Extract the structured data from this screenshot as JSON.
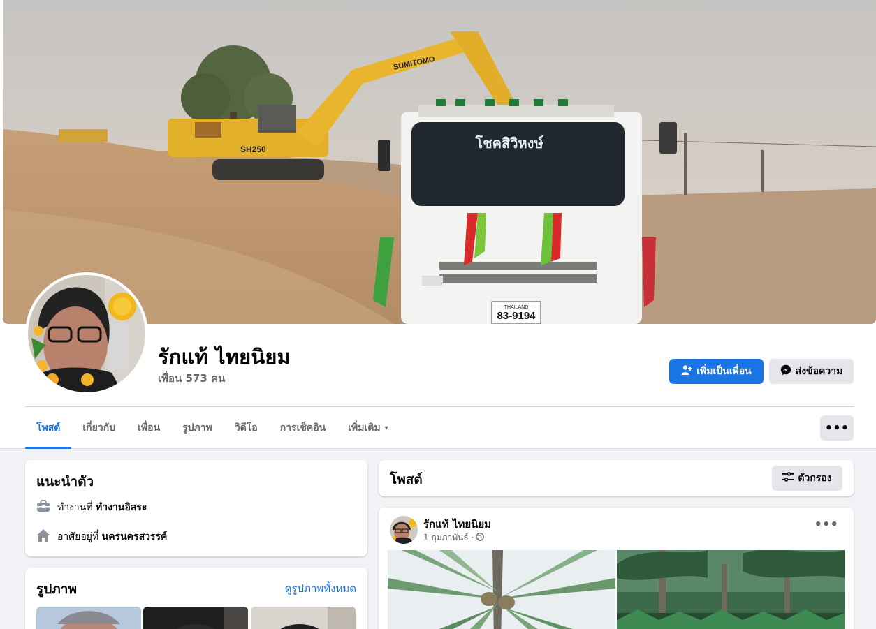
{
  "profile": {
    "name": "รักแท้ ไทยนิยม",
    "friends": "เพื่อน 573 คน"
  },
  "actions": {
    "add_friend": "เพิ่มเป็นเพื่อน",
    "message": "ส่งข้อความ"
  },
  "tabs": [
    {
      "label": "โพสต์",
      "active": true
    },
    {
      "label": "เกี่ยวกับ"
    },
    {
      "label": "เพื่อน"
    },
    {
      "label": "รูปภาพ"
    },
    {
      "label": "วิดีโอ"
    },
    {
      "label": "การเช็คอิน"
    },
    {
      "label": "เพิ่มเติม"
    }
  ],
  "more_icon": "▾",
  "dots": "•••",
  "intro": {
    "title": "แนะนำตัว",
    "work_prefix": "ทำงานที่",
    "work_value": "ทำงานอิสระ",
    "home_prefix": "อาศัยอยู่ที่",
    "home_value": "นครนครสวรรค์"
  },
  "photos": {
    "title": "รูปภาพ",
    "see_all": "ดูรูปภาพทั้งหมด"
  },
  "posts": {
    "title": "โพสต์",
    "filter": "ตัวกรอง"
  },
  "post": {
    "author": "รักแท้ ไทยนิยม",
    "date": "1 กุมภาพันธ์ ·"
  },
  "cover_text": {
    "truck_sign": "โชคสิวิหงษ์",
    "plate_country": "THAILAND",
    "plate": "83-9194",
    "excavator_brand": "SUMITOMO",
    "excavator_model": "SH250"
  },
  "colors": {
    "primary": "#1b74e4",
    "secondary_bg": "#e4e6eb",
    "page_bg": "#f0f2f5"
  }
}
